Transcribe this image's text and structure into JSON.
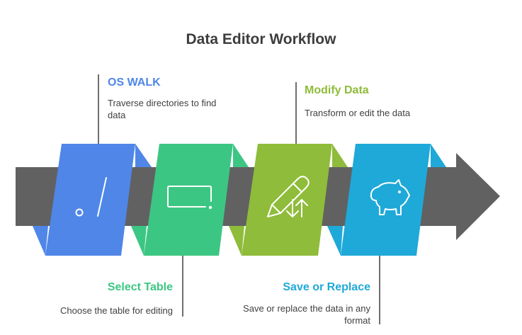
{
  "title": "Data Editor Workflow",
  "colors": {
    "arrow": "#616161",
    "step1": "#4f86e8",
    "step2": "#3cc683",
    "step3": "#8fbc3a",
    "step4": "#1fa9d8",
    "leader": "#3d3d3d"
  },
  "steps": [
    {
      "title": "OS WALK",
      "description": "Traverse directories to find data",
      "icon": "slash-path-icon",
      "color": "#4f86e8"
    },
    {
      "title": "Select Table",
      "description": "Choose the table for editing",
      "icon": "table-select-icon",
      "color": "#3cc683"
    },
    {
      "title": "Modify Data",
      "description": "Transform or edit the data",
      "icon": "pencil-arrows-icon",
      "color": "#8fbc3a"
    },
    {
      "title": "Save or Replace",
      "description": "Save or replace the data in any format",
      "icon": "piggy-bank-icon",
      "color": "#1fa9d8"
    }
  ]
}
